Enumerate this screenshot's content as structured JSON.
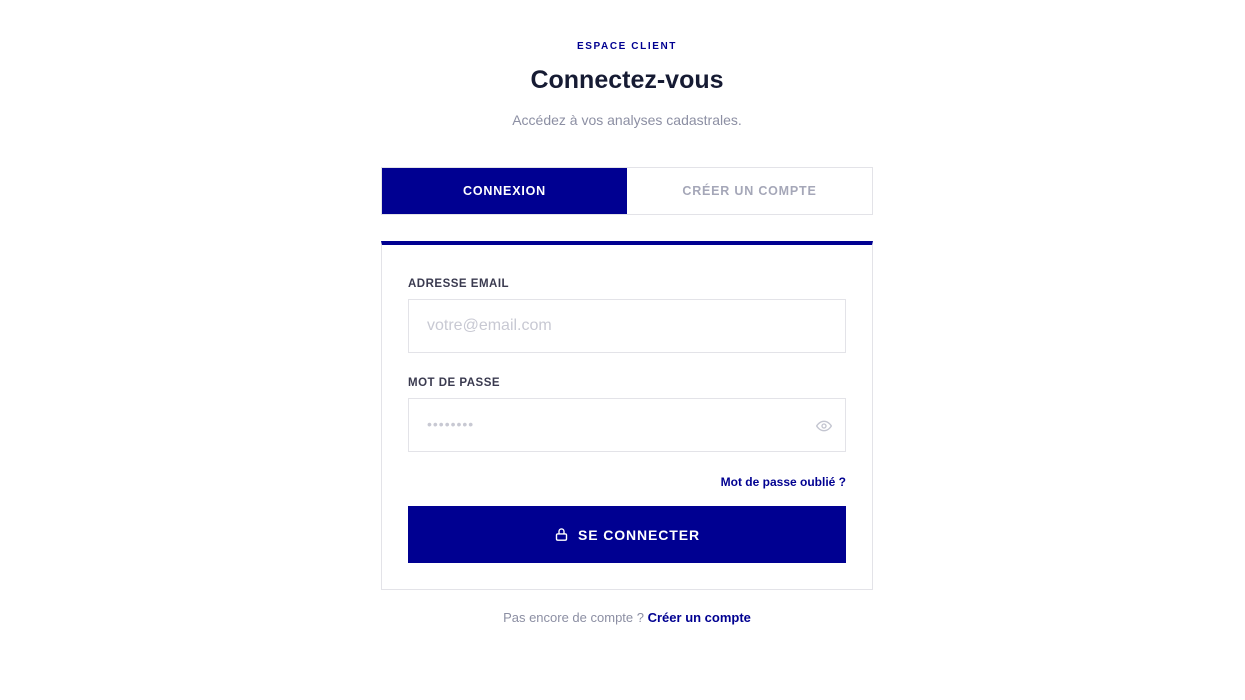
{
  "header": {
    "eyebrow": "ESPACE CLIENT",
    "title": "Connectez-vous",
    "subtitle": "Accédez à vos analyses cadastrales."
  },
  "tabs": [
    {
      "label": "CONNEXION",
      "active": true
    },
    {
      "label": "CRÉER UN COMPTE",
      "active": false
    }
  ],
  "form": {
    "email": {
      "label": "ADRESSE EMAIL",
      "value": "",
      "placeholder": "votre@email.com"
    },
    "password": {
      "label": "MOT DE PASSE",
      "value": "",
      "placeholder": "••••••••"
    },
    "forgot_link": "Mot de passe oublié ?",
    "submit_label": "SE CONNECTER"
  },
  "footer": {
    "text": "Pas encore de compte ?",
    "link": "Créer un compte"
  },
  "icons": {
    "password_toggle": "eye-icon",
    "submit": "lock-icon"
  },
  "colors": {
    "primary": "#000091",
    "text": "#161b33",
    "muted": "#8c8fa3",
    "border": "#e3e3e8"
  }
}
